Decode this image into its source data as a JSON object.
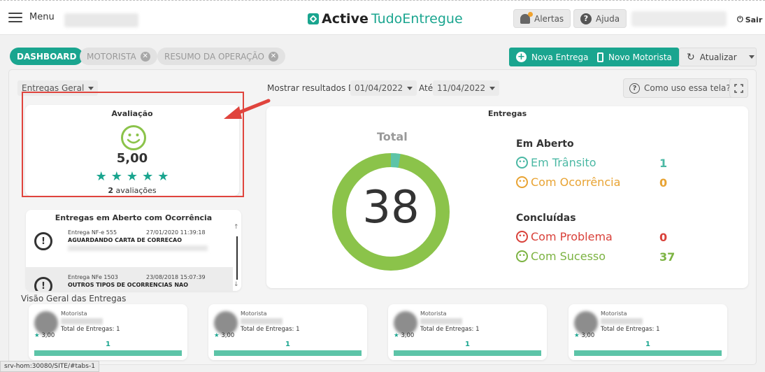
{
  "header": {
    "menu_label": "Menu",
    "logo_bold": "Active",
    "logo_light": "TudoEntregue",
    "alerts_label": "Alertas",
    "help_label": "Ajuda",
    "logout_label": "Sair"
  },
  "tabs": [
    {
      "label": "DASHBOARD",
      "active": true
    },
    {
      "label": "MOTORISTA",
      "active": false
    },
    {
      "label": "RESUMO DA OPERAÇÃO",
      "active": false
    }
  ],
  "actions": {
    "new_delivery": "Nova Entrega",
    "new_driver": "Novo Motorista",
    "refresh": "Atualizar"
  },
  "filters": {
    "view_select": "Entregas Geral",
    "show_results_from": "Mostrar resultados De",
    "date_from": "01/04/2022",
    "until_label": "Até",
    "date_to": "11/04/2022",
    "howto": "Como uso essa tela?"
  },
  "rating": {
    "title": "Avaliação",
    "score": "5,00",
    "stars": 5,
    "count": "2",
    "count_label": "avaliações"
  },
  "occurrences": {
    "title": "Entregas em Aberto com Ocorrência",
    "items": [
      {
        "ref": "Entrega NF-e 555",
        "datetime": "27/01/2020 11:39:18",
        "status": "AGUARDANDO CARTA DE CORRECAO"
      },
      {
        "ref": "Entrega NFe 1503",
        "datetime": "23/08/2018 15:07:39",
        "status": "OUTROS TIPOS DE OCORRENCIAS NAO"
      }
    ]
  },
  "deliveries": {
    "title": "Entregas",
    "total_label": "Total",
    "total": "38",
    "open_title": "Em Aberto",
    "in_transit_label": "Em Trânsito",
    "in_transit": "1",
    "with_occurrence_label": "Com Ocorrência",
    "with_occurrence": "0",
    "done_title": "Concluídas",
    "with_problem_label": "Com Problema",
    "with_problem": "0",
    "success_label": "Com Sucesso",
    "success": "37",
    "colors": {
      "ring_success": "#8bc34a",
      "ring_transit": "#5dc4a8",
      "transit": "#4bb8a4",
      "occurrence": "#e8a333",
      "problem": "#d9413a",
      "success": "#7cb342"
    }
  },
  "overview": {
    "title": "Visão Geral das Entregas",
    "drivers": [
      {
        "label": "Motorista",
        "total_label": "Total de Entregas: 1",
        "rating": "3,00",
        "count": "1",
        "progress": 1.0
      },
      {
        "label": "Motorista",
        "total_label": "Total de Entregas: 1",
        "rating": "3,00",
        "count": "1",
        "progress": 1.0
      },
      {
        "label": "Motorista",
        "total_label": "Total de Entregas: 1",
        "rating": "3,00",
        "count": "1",
        "progress": 1.0
      },
      {
        "label": "Motorista",
        "total_label": "Total de Entregas: 1",
        "rating": "3,00",
        "count": "1",
        "progress": 1.0
      }
    ]
  },
  "status_bar": "srv-hom:30080/SITE/#tabs-1"
}
